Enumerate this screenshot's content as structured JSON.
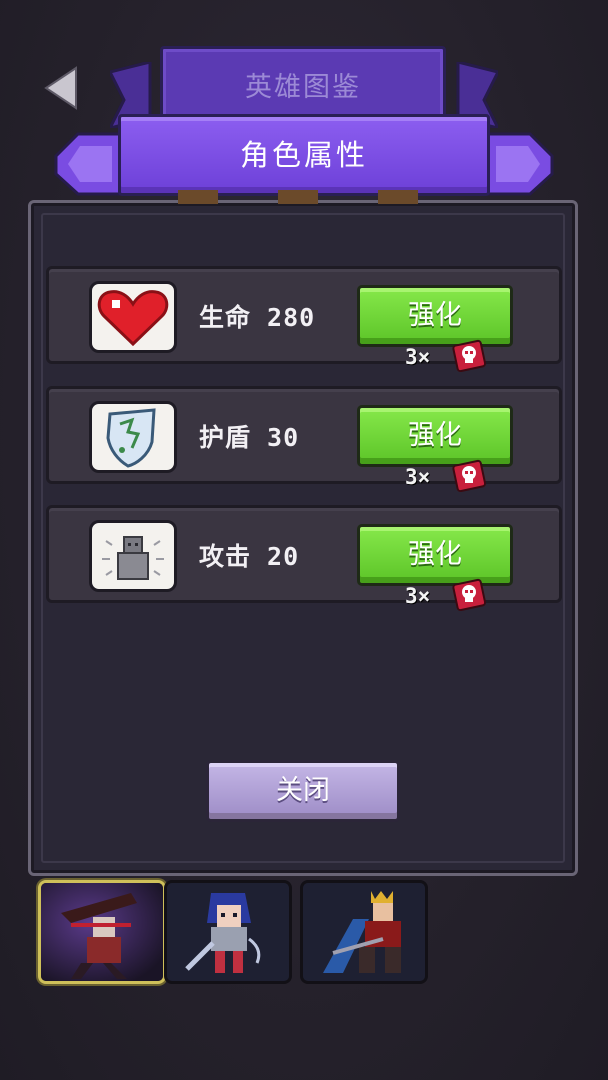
{
  "header": {
    "back_icon": "back-arrow-icon",
    "tab_back_title": "英雄图鉴",
    "tab_front_title": "角色属性"
  },
  "stats": [
    {
      "icon": "heart-icon",
      "label": "生命 280",
      "button": "强化",
      "cost": "3×"
    },
    {
      "icon": "shield-icon",
      "label": "护盾 30",
      "button": "强化",
      "cost": "3×"
    },
    {
      "icon": "attack-statue-icon",
      "label": "攻击 20",
      "button": "强化",
      "cost": "3×"
    }
  ],
  "close_button": "关闭",
  "characters": [
    {
      "icon": "character-ninja-portrait",
      "selected": true
    },
    {
      "icon": "character-swordswoman-portrait",
      "selected": false
    },
    {
      "icon": "character-king-portrait",
      "selected": false
    }
  ],
  "colors": {
    "accent_purple": "#7b4fe0",
    "upgrade_green": "#6fd436",
    "skull_red": "#c8203c"
  }
}
